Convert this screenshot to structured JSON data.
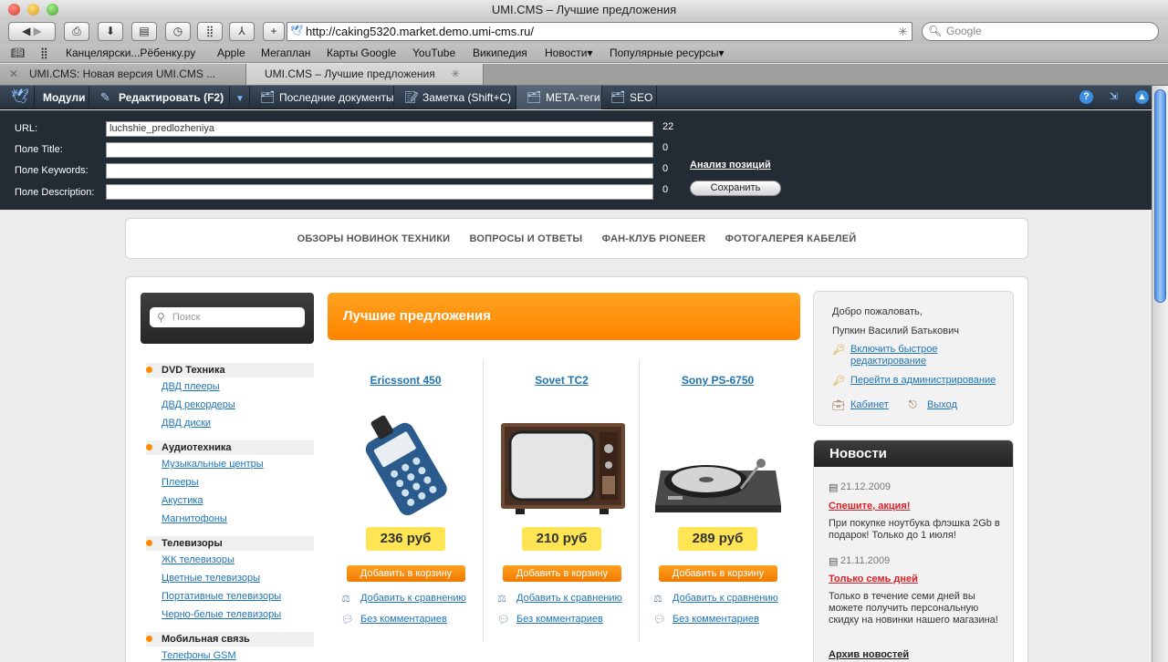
{
  "window": {
    "title": "UMI.CMS – Лучшие предложения"
  },
  "browser": {
    "url": "http://caking5320.market.demo.umi-cms.ru/",
    "search_placeholder": "Google",
    "bookmarks": [
      "Канцелярски...Рёбенку.ру",
      "Apple",
      "Мегаплан",
      "Карты Google",
      "YouTube",
      "Википедия",
      "Новости▾",
      "Популярные ресурсы▾"
    ],
    "tabs": [
      {
        "label": "UMI.CMS: Новая версия UMI.CMS ...",
        "active": false
      },
      {
        "label": "UMI.CMS – Лучшие предложения",
        "active": true
      }
    ]
  },
  "umibar": {
    "modules": "Модули",
    "edit": "Редактировать (F2)",
    "recent": "Последние документы",
    "note": "Заметка (Shift+C)",
    "meta": "META-теги",
    "seo": "SEO"
  },
  "meta_panel": {
    "url_label": "URL:",
    "url_value": "luchshie_predlozheniya",
    "url_count": "22",
    "title_label": "Поле Title:",
    "title_count": "0",
    "keywords_label": "Поле Keywords:",
    "keywords_count": "0",
    "description_label": "Поле Description:",
    "description_count": "0",
    "analyze": "Анализ позиций",
    "save": "Сохранить"
  },
  "topnav": [
    "ОБЗОРЫ НОВИНОК ТЕХНИКИ",
    "ВОПРОСЫ И ОТВЕТЫ",
    "ФАН-КЛУБ PIONEER",
    "ФОТОГАЛЕРЕЯ КАБЕЛЕЙ"
  ],
  "sidebar": {
    "search_placeholder": "Поиск",
    "categories": [
      {
        "title": "DVD Техника",
        "items": [
          "ДВД плееры",
          "ДВД рекордеры",
          "ДВД диски"
        ]
      },
      {
        "title": "Аудиотехника",
        "items": [
          "Музыкальные центры",
          "Плееры",
          "Акустика",
          "Магнитофоны"
        ]
      },
      {
        "title": "Телевизоры",
        "items": [
          "ЖК телевизоры",
          "Цветные телевизоры",
          "Портативные телевизоры",
          "Черно-белые телевизоры"
        ]
      },
      {
        "title": "Мобильная связь",
        "items": [
          "Телефоны GSM"
        ]
      }
    ]
  },
  "main": {
    "title": "Лучшие предложения",
    "products": [
      {
        "name": "Ericssont 450",
        "price": "236 руб",
        "cart": "Добавить в корзину",
        "compare": "Добавить к сравнению",
        "comments": "Без комментариев"
      },
      {
        "name": "Sovet TC2",
        "price": "210 руб",
        "cart": "Добавить в корзину",
        "compare": "Добавить к сравнению",
        "comments": "Без комментариев"
      },
      {
        "name": "Sony PS-6750",
        "price": "289 руб",
        "cart": "Добавить в корзину",
        "compare": "Добавить к сравнению",
        "comments": "Без комментариев"
      }
    ]
  },
  "welcome": {
    "greeting": "Добро пожаловать,",
    "user": "Пупкин Василий Батькович",
    "fast_edit": "Включить быстрое редактирование",
    "admin": "Перейти в администрирование",
    "cabinet": "Кабинет",
    "logout": "Выход"
  },
  "news": {
    "title": "Новости",
    "items": [
      {
        "date": "21.12.2009",
        "headline": "Спешите, акция!",
        "text": "При покупке ноутбука флэшка 2Gb в подарок! Только до 1 июля!"
      },
      {
        "date": "21.11.2009",
        "headline": "Только семь дней",
        "text": "Только в течение семи дней вы можете получить персональную скидку на новинки нашего магазина!"
      }
    ],
    "archive": "Архив новостей"
  },
  "colors": {
    "accent": "#ff8a00",
    "link": "#1d74b6",
    "price_bg": "#ffe553",
    "admin_bar": "#26313e"
  }
}
